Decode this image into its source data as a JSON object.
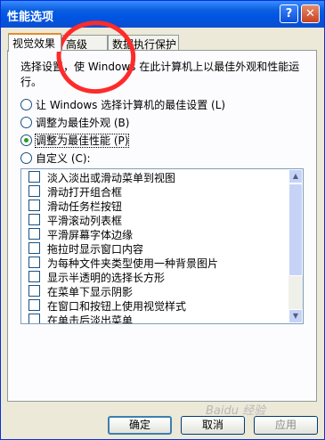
{
  "window": {
    "title": "性能选项",
    "help_label": "?",
    "close_label": "✕"
  },
  "tabs": [
    {
      "label": "视觉效果",
      "active": true
    },
    {
      "label": "高级",
      "active": false
    },
    {
      "label": "数据执行保护",
      "active": false
    }
  ],
  "panel": {
    "description": "选择设置，使 Windows 在此计算机上以最佳外观和性能运行。",
    "radios": [
      {
        "label": "让 Windows 选择计算机的最佳设置 (L)",
        "checked": false
      },
      {
        "label": "调整为最佳外观 (B)",
        "checked": false
      },
      {
        "label": "调整为最佳性能 (P)",
        "checked": true
      },
      {
        "label": "自定义 (C):",
        "checked": false
      }
    ],
    "effects": [
      "淡入淡出或滑动菜单到视图",
      "滑动打开组合框",
      "滑动任务栏按钮",
      "平滑滚动列表框",
      "平滑屏幕字体边缘",
      "拖拉时显示窗口内容",
      "为每种文件夹类型使用一种背景图片",
      "显示半透明的选择长方形",
      "在菜单下显示阴影",
      "在窗口和按钮上使用视觉样式",
      "在单击后淡出菜单"
    ]
  },
  "buttons": {
    "ok": "确定",
    "cancel": "取消",
    "apply": "应用"
  },
  "watermark": "Baidu 经验"
}
